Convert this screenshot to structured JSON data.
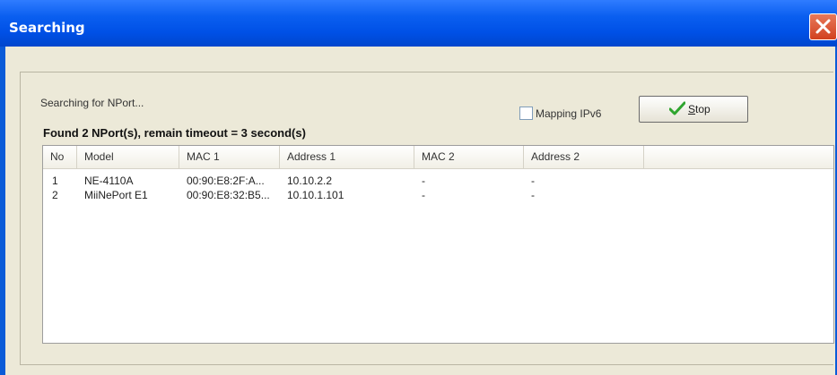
{
  "window": {
    "title": "Searching",
    "close_icon": "close-icon"
  },
  "status": {
    "searching_text": "Searching for NPort...",
    "found_text": "Found 2 NPort(s), remain timeout = 3 second(s)"
  },
  "controls": {
    "mapping_ipv6_label": "Mapping IPv6",
    "mapping_ipv6_checked": false,
    "stop_label_first": "S",
    "stop_label_rest": "top",
    "stop_icon": "checkmark-icon"
  },
  "table": {
    "columns": [
      "No",
      "Model",
      "MAC 1",
      "Address 1",
      "MAC 2",
      "Address 2"
    ],
    "rows": [
      [
        "1",
        "NE-4110A",
        "00:90:E8:2F:A...",
        "10.10.2.2",
        "-",
        "-"
      ],
      [
        "2",
        "MiiNePort E1",
        "00:90:E8:32:B5...",
        "10.10.1.101",
        "-",
        "-"
      ]
    ]
  },
  "colors": {
    "titlebar": "#0050e6",
    "client": "#ece9d8",
    "close": "#d1411f",
    "check": "#2fa52f"
  }
}
